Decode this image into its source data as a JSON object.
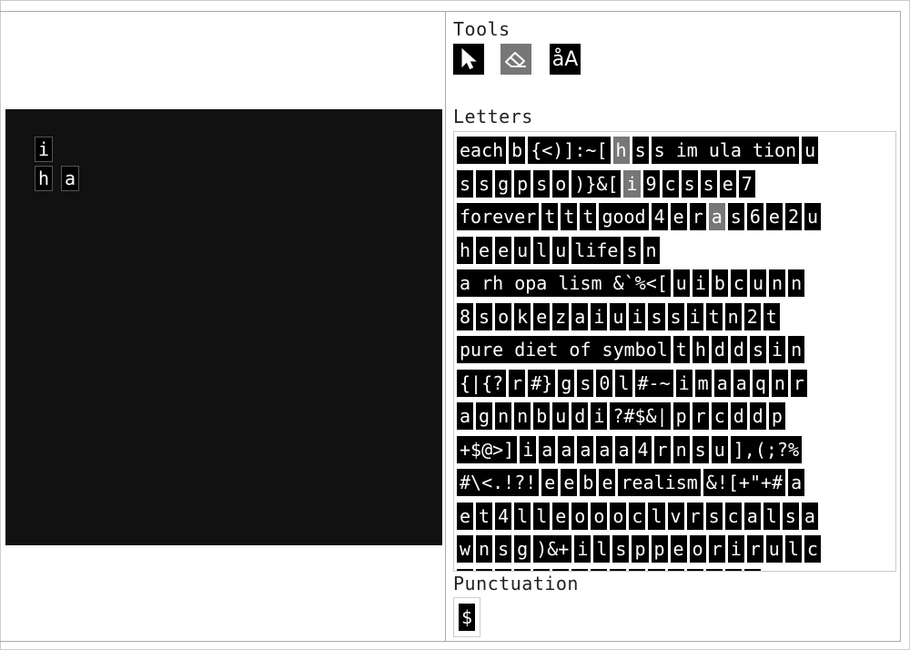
{
  "sections": {
    "tools": "Tools",
    "letters": "Letters",
    "punctuation": "Punctuation"
  },
  "tools": {
    "case_label": "åA",
    "select_icon": "pointer-arrow",
    "eraser_icon": "eraser"
  },
  "canvas_words": [
    "i",
    "h",
    "a"
  ],
  "letter_rows": [
    [
      {
        "t": "each"
      },
      {
        "t": "b"
      },
      {
        "t": "{<)]:~["
      },
      {
        "t": "h",
        "s": true
      },
      {
        "t": "s"
      },
      {
        "t": "s im ula tion"
      },
      {
        "t": "u"
      }
    ],
    [
      {
        "t": "s"
      },
      {
        "t": "s"
      },
      {
        "t": "g"
      },
      {
        "t": "p"
      },
      {
        "t": "s"
      },
      {
        "t": "o"
      },
      {
        "t": ")}&["
      },
      {
        "t": "i",
        "s": true
      },
      {
        "t": "9"
      },
      {
        "t": "c"
      },
      {
        "t": "s"
      },
      {
        "t": "s"
      },
      {
        "t": "e"
      },
      {
        "t": "7"
      }
    ],
    [
      {
        "t": "forever"
      },
      {
        "t": "t"
      },
      {
        "t": "t"
      },
      {
        "t": "t"
      },
      {
        "t": "good"
      },
      {
        "t": "4"
      },
      {
        "t": "e"
      },
      {
        "t": "r"
      },
      {
        "t": "a",
        "s": true
      },
      {
        "t": "s"
      },
      {
        "t": "6"
      },
      {
        "t": "e"
      },
      {
        "t": "2"
      },
      {
        "t": "u"
      }
    ],
    [
      {
        "t": "h"
      },
      {
        "t": "e"
      },
      {
        "t": "e"
      },
      {
        "t": "u"
      },
      {
        "t": "l"
      },
      {
        "t": "u"
      },
      {
        "t": "life"
      },
      {
        "t": "s"
      },
      {
        "t": "n"
      }
    ],
    [
      {
        "t": "a rh opa lism &`%<["
      },
      {
        "t": "u"
      },
      {
        "t": "i"
      },
      {
        "t": "b"
      },
      {
        "t": "c"
      },
      {
        "t": "u"
      },
      {
        "t": "n"
      },
      {
        "t": "n"
      }
    ],
    [
      {
        "t": "8"
      },
      {
        "t": "s"
      },
      {
        "t": "o"
      },
      {
        "t": "k"
      },
      {
        "t": "e"
      },
      {
        "t": "z"
      },
      {
        "t": "a"
      },
      {
        "t": "i"
      },
      {
        "t": "u"
      },
      {
        "t": "i"
      },
      {
        "t": "s"
      },
      {
        "t": "s"
      },
      {
        "t": "i"
      },
      {
        "t": "t"
      },
      {
        "t": "n"
      },
      {
        "t": "2"
      },
      {
        "t": "t"
      }
    ],
    [
      {
        "t": "pure diet of symbol"
      },
      {
        "t": "t"
      },
      {
        "t": "h"
      },
      {
        "t": "d"
      },
      {
        "t": "d"
      },
      {
        "t": "s"
      },
      {
        "t": "i"
      },
      {
        "t": "n"
      }
    ],
    [
      {
        "t": "{|{?"
      },
      {
        "t": "r"
      },
      {
        "t": "#}"
      },
      {
        "t": "g"
      },
      {
        "t": "s"
      },
      {
        "t": "0"
      },
      {
        "t": "l"
      },
      {
        "t": "#-~"
      },
      {
        "t": "i"
      },
      {
        "t": "m"
      },
      {
        "t": "a"
      },
      {
        "t": "a"
      },
      {
        "t": "q"
      },
      {
        "t": "n"
      },
      {
        "t": "r"
      }
    ],
    [
      {
        "t": "a"
      },
      {
        "t": "g"
      },
      {
        "t": "n"
      },
      {
        "t": "n"
      },
      {
        "t": "b"
      },
      {
        "t": "u"
      },
      {
        "t": "d"
      },
      {
        "t": "i"
      },
      {
        "t": "?#$&|"
      },
      {
        "t": "p"
      },
      {
        "t": "r"
      },
      {
        "t": "c"
      },
      {
        "t": "d"
      },
      {
        "t": "d"
      },
      {
        "t": "p"
      }
    ],
    [
      {
        "t": "+$@>]"
      },
      {
        "t": "i"
      },
      {
        "t": "a"
      },
      {
        "t": "a"
      },
      {
        "t": "a"
      },
      {
        "t": "a"
      },
      {
        "t": "a"
      },
      {
        "t": "4"
      },
      {
        "t": "r"
      },
      {
        "t": "n"
      },
      {
        "t": "s"
      },
      {
        "t": "u"
      },
      {
        "t": "],(;?%"
      }
    ],
    [
      {
        "t": "#\\<.!?!"
      },
      {
        "t": "e"
      },
      {
        "t": "e"
      },
      {
        "t": "b"
      },
      {
        "t": "e"
      },
      {
        "t": "realism"
      },
      {
        "t": "&![+\"+#"
      },
      {
        "t": "a"
      }
    ],
    [
      {
        "t": "e"
      },
      {
        "t": "t"
      },
      {
        "t": "4"
      },
      {
        "t": "l"
      },
      {
        "t": "l"
      },
      {
        "t": "e"
      },
      {
        "t": "o"
      },
      {
        "t": "o"
      },
      {
        "t": "o"
      },
      {
        "t": "c"
      },
      {
        "t": "l"
      },
      {
        "t": "v"
      },
      {
        "t": "r"
      },
      {
        "t": "s"
      },
      {
        "t": "c"
      },
      {
        "t": "a"
      },
      {
        "t": "l"
      },
      {
        "t": "s"
      },
      {
        "t": "a"
      }
    ],
    [
      {
        "t": "w"
      },
      {
        "t": "n"
      },
      {
        "t": "s"
      },
      {
        "t": "g"
      },
      {
        "t": ")&+"
      },
      {
        "t": "i"
      },
      {
        "t": "l"
      },
      {
        "t": "s"
      },
      {
        "t": "p"
      },
      {
        "t": "p"
      },
      {
        "t": "e"
      },
      {
        "t": "o"
      },
      {
        "t": "r"
      },
      {
        "t": "i"
      },
      {
        "t": "r"
      },
      {
        "t": "u"
      },
      {
        "t": "l"
      },
      {
        "t": "c"
      }
    ],
    [
      {
        "t": "o"
      },
      {
        "t": "o"
      },
      {
        "t": "o"
      },
      {
        "t": "o"
      },
      {
        "t": "o"
      },
      {
        "t": "o"
      },
      {
        "t": "o"
      },
      {
        "t": "o"
      },
      {
        "t": "o"
      },
      {
        "t": "o"
      },
      {
        "t": "o"
      },
      {
        "t": "o"
      },
      {
        "t": "o"
      },
      {
        "t": "o"
      },
      {
        "t": "o"
      },
      {
        "t": "o"
      }
    ]
  ],
  "punctuation_tiles": [
    "$"
  ]
}
